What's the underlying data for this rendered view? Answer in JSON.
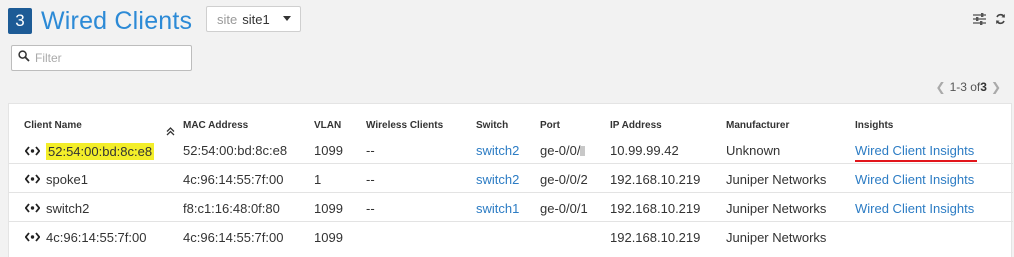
{
  "header": {
    "count": "3",
    "title": "Wired Clients"
  },
  "site_selector": {
    "label": "site",
    "value": "site1"
  },
  "filter": {
    "placeholder": "Filter",
    "value": ""
  },
  "pagination": {
    "range": "1-3 of ",
    "total": "3"
  },
  "table": {
    "columns": [
      "Client Name",
      "MAC Address",
      "VLAN",
      "Wireless Clients",
      "Switch",
      "Port",
      "IP Address",
      "Manufacturer",
      "Insights"
    ],
    "rows": [
      {
        "client_name": "52:54:00:bd:8c:e8",
        "mac": "52:54:00:bd:8c:e8",
        "vlan": "1099",
        "wireless_clients": "--",
        "switch": "switch2",
        "port": "ge-0/0/",
        "ip": "10.99.99.42",
        "manufacturer": "Unknown",
        "insights": "Wired Client Insights"
      },
      {
        "client_name": "spoke1",
        "mac": "4c:96:14:55:7f:00",
        "vlan": "1",
        "wireless_clients": "--",
        "switch": "switch2",
        "port": "ge-0/0/2",
        "ip": "192.168.10.219",
        "manufacturer": "Juniper Networks",
        "insights": "Wired Client Insights"
      },
      {
        "client_name": "switch2",
        "mac": "f8:c1:16:48:0f:80",
        "vlan": "1099",
        "wireless_clients": "--",
        "switch": "switch1",
        "port": "ge-0/0/1",
        "ip": "192.168.10.219",
        "manufacturer": "Juniper Networks",
        "insights": "Wired Client Insights"
      },
      {
        "client_name": "4c:96:14:55:7f:00",
        "mac": "4c:96:14:55:7f:00",
        "vlan": "1099",
        "wireless_clients": "",
        "switch": "",
        "port": "",
        "ip": "192.168.10.219",
        "manufacturer": "Juniper Networks",
        "insights": ""
      }
    ]
  },
  "colors": {
    "accent": "#2c8ad6",
    "badge": "#1d5b96",
    "link": "#2c7cc4",
    "highlight": "#f3ee2a",
    "underline": "#e2161c"
  },
  "icons": [
    "filter-settings-icon",
    "refresh-icon",
    "search-icon",
    "sort-icon",
    "client-icon"
  ]
}
